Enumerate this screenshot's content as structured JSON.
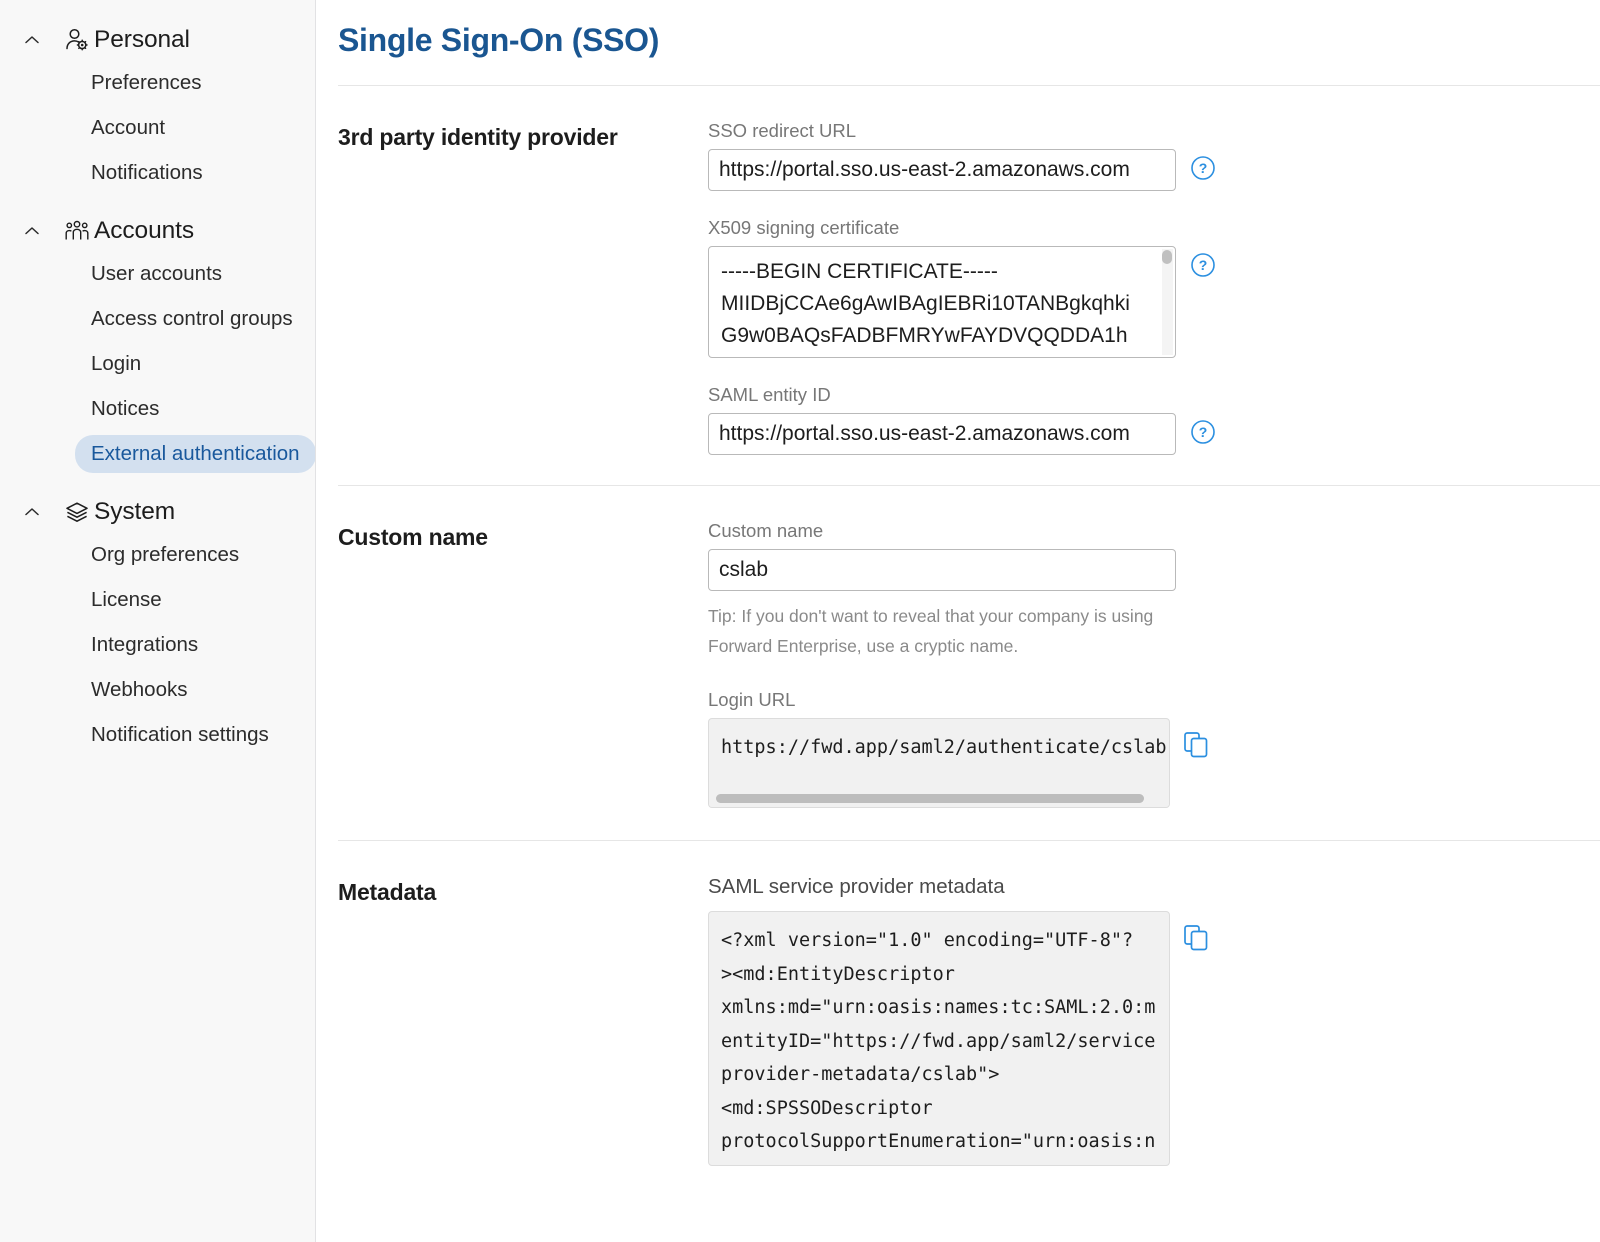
{
  "sidebar": {
    "groups": [
      {
        "label": "Personal",
        "icon": "person-gear-icon",
        "items": [
          {
            "label": "Preferences",
            "active": false
          },
          {
            "label": "Account",
            "active": false
          },
          {
            "label": "Notifications",
            "active": false
          }
        ]
      },
      {
        "label": "Accounts",
        "icon": "people-group-icon",
        "items": [
          {
            "label": "User accounts",
            "active": false
          },
          {
            "label": "Access control groups",
            "active": false
          },
          {
            "label": "Login",
            "active": false
          },
          {
            "label": "Notices",
            "active": false
          },
          {
            "label": "External authentication",
            "active": true
          }
        ]
      },
      {
        "label": "System",
        "icon": "layers-icon",
        "items": [
          {
            "label": "Org preferences",
            "active": false
          },
          {
            "label": "License",
            "active": false
          },
          {
            "label": "Integrations",
            "active": false
          },
          {
            "label": "Webhooks",
            "active": false
          },
          {
            "label": "Notification settings",
            "active": false
          }
        ]
      }
    ]
  },
  "page": {
    "title": "Single Sign-On (SSO)",
    "accent_color": "#1a5691",
    "active_pill_bg": "#d3e0ef",
    "active_pill_color": "#19589c",
    "icon_blue": "#2b8fe0"
  },
  "sections": {
    "identity_provider": {
      "title": "3rd party identity provider",
      "sso_redirect_url": {
        "label": "SSO redirect URL",
        "value": "https://portal.sso.us-east-2.amazonaws.com",
        "help_icon": "help-circle-icon"
      },
      "x509_certificate": {
        "label": "X509 signing certificate",
        "lines": [
          "-----BEGIN CERTIFICATE-----",
          "MIIDBjCCAe6gAwIBAgIEBRi10TANBgkqhki",
          "G9w0BAQsFADBFMRYwFAYDVQQDDA1h"
        ],
        "help_icon": "help-circle-icon"
      },
      "saml_entity_id": {
        "label": "SAML entity ID",
        "value": "https://portal.sso.us-east-2.amazonaws.com",
        "help_icon": "help-circle-icon"
      }
    },
    "custom_name": {
      "title": "Custom name",
      "field_label": "Custom name",
      "value": "cslab",
      "tip_line_1": "Tip: If you don't want to reveal that your company is using",
      "tip_line_2": "Forward Enterprise, use a cryptic name.",
      "login_url": {
        "label": "Login URL",
        "value": "https://fwd.app/saml2/authenticate/cslab",
        "copy_icon": "copy-icon"
      }
    },
    "metadata": {
      "title": "Metadata",
      "field_label": "SAML service provider metadata",
      "xml_lines": [
        "<?xml version=\"1.0\" encoding=\"UTF-8\"?",
        "><md:EntityDescriptor",
        "xmlns:md=\"urn:oasis:names:tc:SAML:2.0:m",
        "entityID=\"https://fwd.app/saml2/service",
        "provider-metadata/cslab\">",
        "    <md:SPSSODescriptor",
        "protocolSupportEnumeration=\"urn:oasis:n"
      ],
      "copy_icon": "copy-icon"
    }
  }
}
